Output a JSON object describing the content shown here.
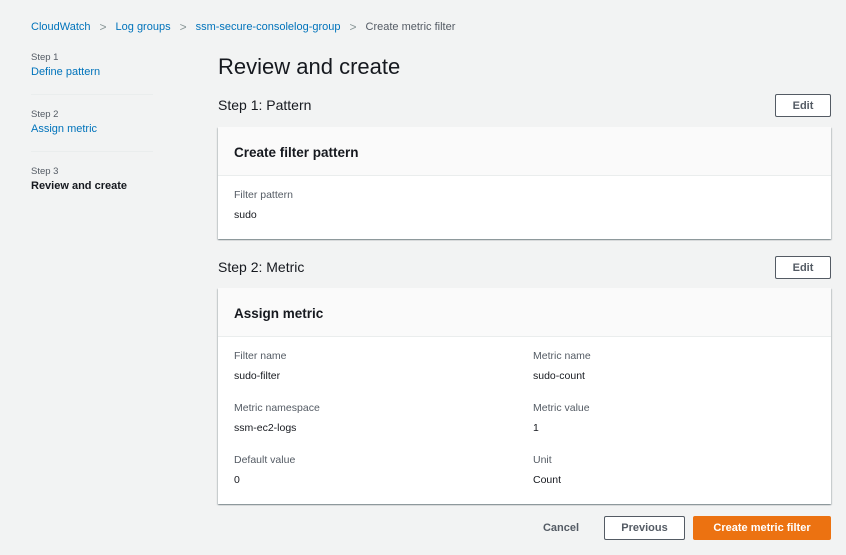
{
  "breadcrumb": [
    "CloudWatch",
    "Log groups",
    "ssm-secure-consolelog-group",
    "Create metric filter"
  ],
  "steps": [
    {
      "step": "Step 1",
      "label": "Define pattern"
    },
    {
      "step": "Step 2",
      "label": "Assign metric"
    },
    {
      "step": "Step 3",
      "label": "Review and create"
    }
  ],
  "title": "Review and create",
  "section1": {
    "title": "Step 1: Pattern",
    "edit": "Edit",
    "card_title": "Create filter pattern",
    "fields": [
      {
        "k": "Filter pattern",
        "v": "sudo"
      }
    ]
  },
  "section2": {
    "title": "Step 2: Metric",
    "edit": "Edit",
    "card_title": "Assign metric",
    "fields": [
      {
        "k": "Filter name",
        "v": "sudo-filter"
      },
      {
        "k": "Metric name",
        "v": "sudo-count"
      },
      {
        "k": "Metric namespace",
        "v": "ssm-ec2-logs"
      },
      {
        "k": "Metric value",
        "v": "1"
      },
      {
        "k": "Default value",
        "v": "0"
      },
      {
        "k": "Unit",
        "v": "Count"
      }
    ]
  },
  "actions": {
    "cancel": "Cancel",
    "previous": "Previous",
    "create": "Create metric filter"
  },
  "colors": {
    "accent": "#ec7211",
    "link": "#0073bb"
  }
}
